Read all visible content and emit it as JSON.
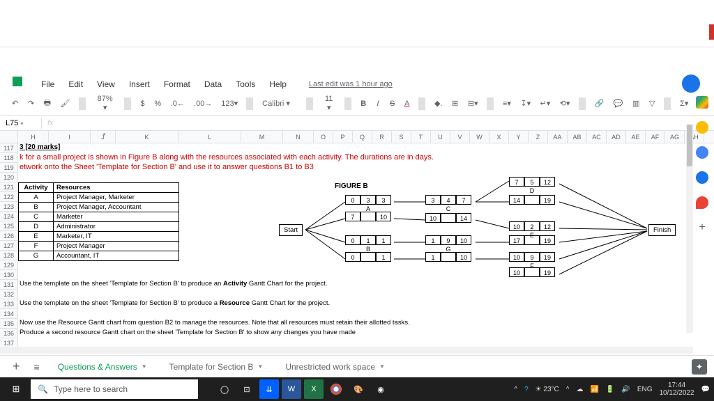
{
  "menu": {
    "file": "File",
    "edit": "Edit",
    "view": "View",
    "insert": "Insert",
    "format": "Format",
    "data": "Data",
    "tools": "Tools",
    "help": "Help",
    "last_edit": "Last edit was 1 hour ago"
  },
  "toolbar": {
    "zoom": "87%",
    "dollar": "$",
    "percent": "%",
    "dec0": ".0_",
    "dec00": ".00_",
    "fmt123": "123",
    "font": "Calibri",
    "size": "11",
    "bold": "B",
    "italic": "I",
    "strike": "S",
    "textcolor": "A"
  },
  "namebox": "L75",
  "columns": [
    "H",
    "I",
    "J",
    "K",
    "L",
    "M",
    "N",
    "O",
    "P",
    "Q",
    "R",
    "S",
    "T",
    "U",
    "V",
    "W",
    "X",
    "Y",
    "Z",
    "AA",
    "AB",
    "AC",
    "AD",
    "AE",
    "AF",
    "AG",
    "AH"
  ],
  "rows": [
    "117",
    "118",
    "119",
    "120",
    "121",
    "122",
    "123",
    "124",
    "125",
    "126",
    "127",
    "128",
    "129",
    "130",
    "131",
    "132",
    "133",
    "134",
    "135",
    "136",
    "137"
  ],
  "content": {
    "title": "3 [20 marks]",
    "line1": "k for a small project is shown in Figure B along with the resources associated with each activity. The durations are in days.",
    "line2": "etwork onto the Sheet 'Template for Section B' and use it to answer questions B1 to B3",
    "thead_act": "Activity",
    "thead_res": "Resources",
    "rows": [
      {
        "a": "A",
        "r": "Project Manager, Marketer"
      },
      {
        "a": "B",
        "r": "Project Manager, Accountant"
      },
      {
        "a": "C",
        "r": "Marketer"
      },
      {
        "a": "D",
        "r": "Administrator"
      },
      {
        "a": "E",
        "r": "Marketer, IT"
      },
      {
        "a": "F",
        "r": "Project Manager"
      },
      {
        "a": "G",
        "r": "Accountant, IT"
      }
    ],
    "figureb": "FIGURE B",
    "start": "Start",
    "finish": "Finish",
    "nodes": {
      "A": {
        "t": [
          "0",
          "3",
          "3"
        ],
        "b": [
          "",
          "A",
          ""
        ]
      },
      "B": {
        "t": [
          "7",
          "",
          "10"
        ],
        "b": [
          "",
          "",
          ""
        ]
      },
      "E": {
        "t": [
          "0",
          "1",
          "1"
        ],
        "b": [
          "",
          "B",
          ""
        ]
      },
      "F": {
        "t": [
          "0",
          "",
          "1"
        ],
        "b": [
          "",
          "",
          ""
        ]
      },
      "C": {
        "t": [
          "3",
          "4",
          "7"
        ],
        "b": [
          "",
          "C",
          ""
        ]
      },
      "D": {
        "t": [
          "10",
          "",
          "14"
        ],
        "b": [
          "",
          "",
          ""
        ]
      },
      "EE": {
        "t": [
          "1",
          "9",
          "10"
        ],
        "b": [
          "",
          "G",
          ""
        ]
      },
      "FF": {
        "t": [
          "1",
          "",
          "10"
        ],
        "b": [
          "",
          "",
          ""
        ]
      },
      "X1": {
        "t": [
          "7",
          "5",
          "12"
        ],
        "b": [
          "",
          "D",
          ""
        ]
      },
      "X2": {
        "t": [
          "14",
          "",
          "19"
        ],
        "b": [
          "",
          "",
          ""
        ]
      },
      "X3": {
        "t": [
          "10",
          "2",
          "12"
        ],
        "b": [
          "",
          "E",
          ""
        ]
      },
      "X4": {
        "t": [
          "17",
          "",
          "19"
        ],
        "b": [
          "",
          "",
          ""
        ]
      },
      "X5": {
        "t": [
          "10",
          "9",
          "19"
        ],
        "b": [
          "",
          "F",
          ""
        ]
      },
      "X6": {
        "t": [
          "10",
          "",
          "19"
        ],
        "b": [
          "",
          "",
          ""
        ]
      }
    },
    "instr1": "Use the template on the sheet 'Template for Section B' to produce an Activity Gantt Chart for the project.",
    "instr2": "Use the template on the sheet 'Template for Section B' to produce a Resource Gantt Chart for the project.",
    "instr3": "Now use the Resource Gantt chart from question B2 to manage the resources. Note that all resources must retain their allotted tasks.",
    "instr4": "Produce a second resource Gantt chart on the sheet 'Template for Section B' to show any changes you have made"
  },
  "tabs": {
    "t1": "Questions & Answers",
    "t2": "Template for Section B",
    "t3": "Unrestricted work space"
  },
  "taskbar": {
    "search": "Type here to search",
    "weather": "23°C",
    "lang": "ENG",
    "time": "17:44",
    "date": "10/12/2022"
  }
}
